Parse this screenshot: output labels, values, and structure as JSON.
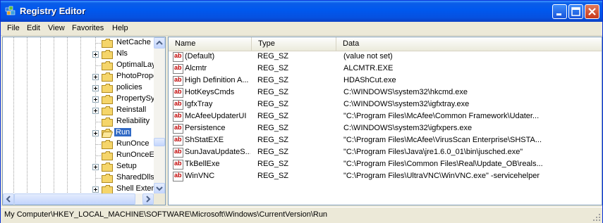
{
  "window": {
    "title": "Registry Editor"
  },
  "menu": [
    "File",
    "Edit",
    "View",
    "Favorites",
    "Help"
  ],
  "tree": {
    "items": [
      {
        "label": "NetCache",
        "expandable": false,
        "selected": false
      },
      {
        "label": "Nls",
        "expandable": true,
        "selected": false
      },
      {
        "label": "OptimalLay",
        "expandable": false,
        "selected": false
      },
      {
        "label": "PhotoPrope",
        "expandable": true,
        "selected": false
      },
      {
        "label": "policies",
        "expandable": true,
        "selected": false
      },
      {
        "label": "PropertySy",
        "expandable": true,
        "selected": false
      },
      {
        "label": "Reinstall",
        "expandable": true,
        "selected": false
      },
      {
        "label": "Reliability",
        "expandable": false,
        "selected": false
      },
      {
        "label": "Run",
        "expandable": true,
        "selected": true
      },
      {
        "label": "RunOnce",
        "expandable": false,
        "selected": false
      },
      {
        "label": "RunOnceEx",
        "expandable": false,
        "selected": false
      },
      {
        "label": "Setup",
        "expandable": true,
        "selected": false
      },
      {
        "label": "SharedDlls",
        "expandable": false,
        "selected": false
      },
      {
        "label": "Shell Exten",
        "expandable": true,
        "selected": false
      }
    ]
  },
  "list": {
    "columns": [
      "Name",
      "Type",
      "Data"
    ],
    "rows": [
      {
        "name": "(Default)",
        "type": "REG_SZ",
        "data": "(value not set)"
      },
      {
        "name": "Alcmtr",
        "type": "REG_SZ",
        "data": "ALCMTR.EXE"
      },
      {
        "name": "High Definition A...",
        "type": "REG_SZ",
        "data": "HDAShCut.exe"
      },
      {
        "name": "HotKeysCmds",
        "type": "REG_SZ",
        "data": "C:\\WINDOWS\\system32\\hkcmd.exe"
      },
      {
        "name": "IgfxTray",
        "type": "REG_SZ",
        "data": "C:\\WINDOWS\\system32\\igfxtray.exe"
      },
      {
        "name": "McAfeeUpdaterUI",
        "type": "REG_SZ",
        "data": "\"C:\\Program Files\\McAfee\\Common Framework\\Udater..."
      },
      {
        "name": "Persistence",
        "type": "REG_SZ",
        "data": "C:\\WINDOWS\\system32\\igfxpers.exe"
      },
      {
        "name": "ShStatEXE",
        "type": "REG_SZ",
        "data": "\"C:\\Program Files\\McAfee\\VirusScan Enterprise\\SHSTA..."
      },
      {
        "name": "SunJavaUpdateS...",
        "type": "REG_SZ",
        "data": "\"C:\\Program Files\\Java\\jre1.6.0_01\\bin\\jusched.exe\""
      },
      {
        "name": "TkBellExe",
        "type": "REG_SZ",
        "data": "\"C:\\Program Files\\Common Files\\Real\\Update_OB\\reals..."
      },
      {
        "name": "WinVNC",
        "type": "REG_SZ",
        "data": "\"C:\\Program Files\\UltraVNC\\WinVNC.exe\" -servicehelper"
      }
    ]
  },
  "status": {
    "path": "My Computer\\HKEY_LOCAL_MACHINE\\SOFTWARE\\Microsoft\\Windows\\CurrentVersion\\Run"
  },
  "icons": {
    "app": "registry-editor-icon",
    "folder": "folder-icon",
    "value": "string-value-icon"
  },
  "colors": {
    "titlebar": "#0058ee",
    "selection": "#316ac5",
    "close_button": "#c8391b"
  }
}
